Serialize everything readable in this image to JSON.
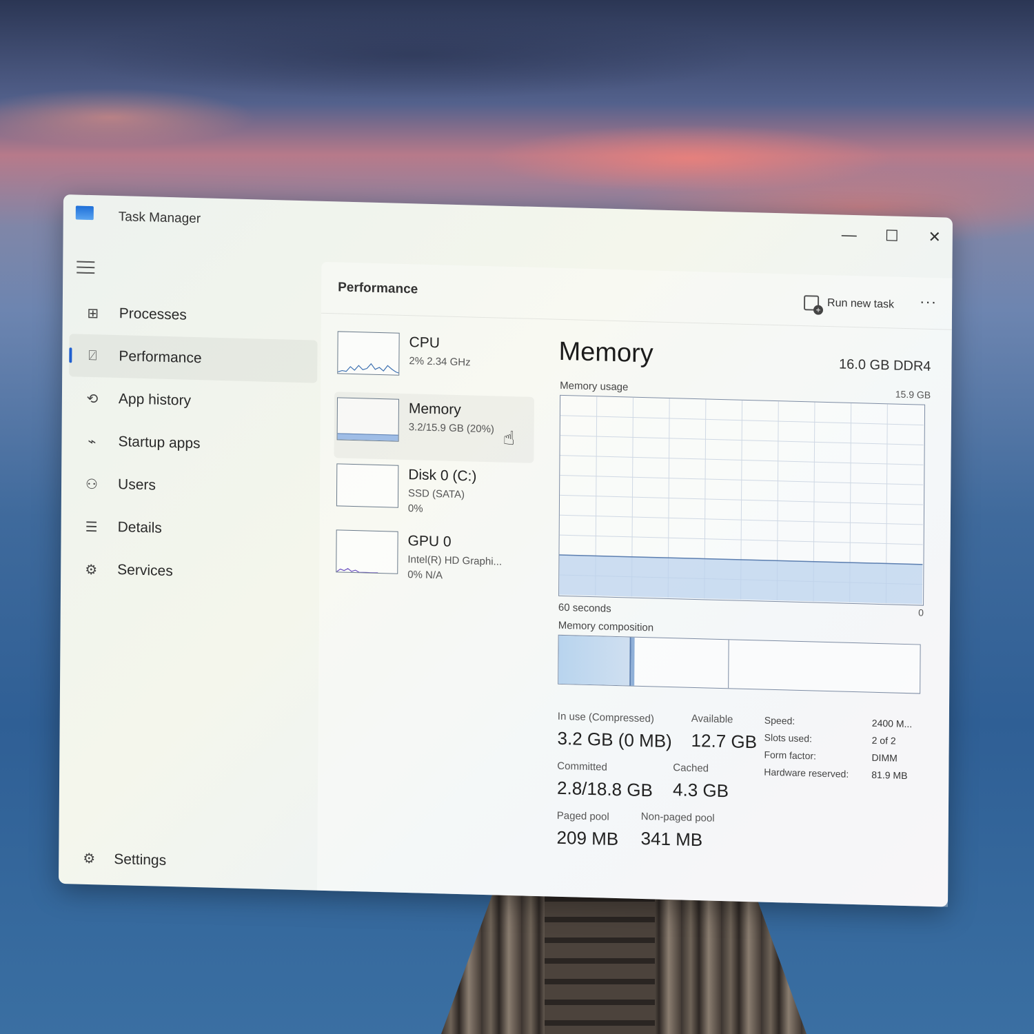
{
  "window": {
    "title": "Task Manager",
    "controls": {
      "minimize": "—",
      "maximize": "☐",
      "close": "✕"
    }
  },
  "sidebar": {
    "items": [
      {
        "label": "Processes",
        "icon": "processes-icon",
        "glyph": "⊞"
      },
      {
        "label": "Performance",
        "icon": "performance-icon",
        "glyph": "⍁",
        "active": true
      },
      {
        "label": "App history",
        "icon": "history-icon",
        "glyph": "⟲"
      },
      {
        "label": "Startup apps",
        "icon": "startup-icon",
        "glyph": "⌁"
      },
      {
        "label": "Users",
        "icon": "users-icon",
        "glyph": "⚇"
      },
      {
        "label": "Details",
        "icon": "details-icon",
        "glyph": "☰"
      },
      {
        "label": "Services",
        "icon": "services-icon",
        "glyph": "⚙"
      }
    ],
    "settings": {
      "label": "Settings",
      "glyph": "⚙"
    }
  },
  "header": {
    "title": "Performance",
    "run_new_task": "Run new task",
    "more": "···"
  },
  "resources": [
    {
      "name": "CPU",
      "sub1": "2% 2.34 GHz",
      "sub2": ""
    },
    {
      "name": "Memory",
      "sub1": "3.2/15.9 GB (20%)",
      "sub2": "",
      "selected": true
    },
    {
      "name": "Disk 0 (C:)",
      "sub1": "SSD (SATA)",
      "sub2": "0%"
    },
    {
      "name": "GPU 0",
      "sub1": "Intel(R) HD Graphi...",
      "sub2": "0% N/A"
    }
  ],
  "memory": {
    "title": "Memory",
    "spec": "16.0 GB DDR4",
    "usage_label": "Memory usage",
    "usage_max": "15.9 GB",
    "graph_left": "60 seconds",
    "graph_right": "0",
    "composition_label": "Memory composition",
    "usage_fraction": 0.2,
    "composition": {
      "in_use_fraction": 0.2,
      "modified_fraction": 0.01,
      "standby_fraction": 0.26
    },
    "stats": {
      "in_use_label": "In use (Compressed)",
      "in_use_value": "3.2 GB (0 MB)",
      "available_label": "Available",
      "available_value": "12.7 GB",
      "committed_label": "Committed",
      "committed_value": "2.8/18.8 GB",
      "cached_label": "Cached",
      "cached_value": "4.3 GB",
      "paged_label": "Paged pool",
      "paged_value": "209 MB",
      "nonpaged_label": "Non-paged pool",
      "nonpaged_value": "341 MB"
    },
    "properties": [
      {
        "key": "Speed:",
        "value": "2400 M..."
      },
      {
        "key": "Slots used:",
        "value": "2 of 2"
      },
      {
        "key": "Form factor:",
        "value": "DIMM"
      },
      {
        "key": "Hardware reserved:",
        "value": "81.9 MB"
      }
    ]
  },
  "colors": {
    "accent": "#1f5fd0",
    "graph_line": "#5b7eb0",
    "graph_fill": "#bcd3ee"
  }
}
